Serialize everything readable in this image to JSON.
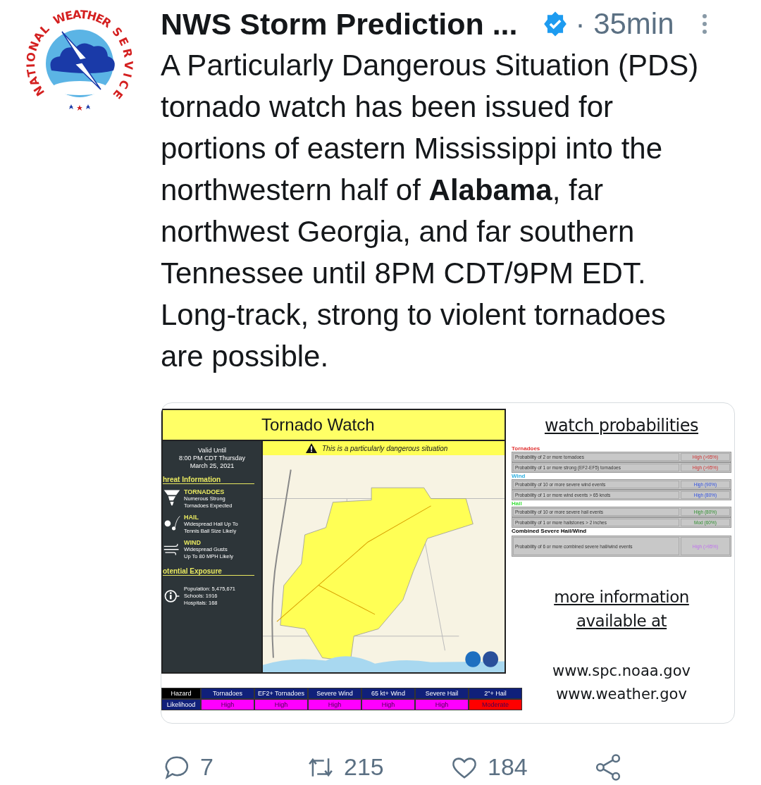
{
  "avatar": {
    "ring_words": [
      "NATIONAL",
      "WEATHER",
      "SERVICE"
    ]
  },
  "tweet": {
    "author": "NWS Storm Prediction ...",
    "verified": true,
    "time": "· 35min",
    "text": "A Particularly Dangerous Situation (PDS) tornado watch has been issued for portions of eastern Mississippi into the northwestern half of **Alabama**, far northwest Georgia, and far southern Tennessee until 8PM CDT/9PM EDT. Long-track, strong to violent tornadoes are possible."
  },
  "graphic": {
    "title": "Tornado Watch",
    "valid": [
      "Valid Until",
      "8:00 PM CDT Thursday",
      "March 25, 2021"
    ],
    "threat_heading": "hreat Information",
    "threats": [
      {
        "kind": "tornado",
        "name": "TORNADOES",
        "detail": [
          "Numerous Strong",
          "Tornadoes Expected"
        ]
      },
      {
        "kind": "hail",
        "name": "HAIL",
        "detail": [
          "Widespread Hail Up To",
          "Tennis Ball Size Likely"
        ]
      },
      {
        "kind": "wind",
        "name": "WIND",
        "detail": [
          "Widespread Gusts",
          "Up To 80 MPH Likely"
        ]
      }
    ],
    "exposure_heading": "otential Exposure",
    "exposure": [
      "Population: 5,475,671",
      "Schools: 1916",
      "Hospitals: 168"
    ],
    "banner": "This is a particularly dangerous situation",
    "map": {
      "kind": "picture"
    },
    "hazard_table": {
      "row_labels": [
        "Hazard",
        "Likelihood"
      ],
      "columns": [
        {
          "hazard": "Tornadoes",
          "likelihood": "High",
          "color": "#ff00ff"
        },
        {
          "hazard": "EF2+ Tornadoes",
          "likelihood": "High",
          "color": "#ff00ff"
        },
        {
          "hazard": "Severe Wind",
          "likelihood": "High",
          "color": "#ff00ff"
        },
        {
          "hazard": "65 kt+ Wind",
          "likelihood": "High",
          "color": "#ff00ff"
        },
        {
          "hazard": "Severe Hail",
          "likelihood": "High",
          "color": "#ff00ff"
        },
        {
          "hazard": "2\"+ Hail",
          "likelihood": "Moderate",
          "color": "#ff0000"
        }
      ]
    },
    "probabilities_heading": "watch probabilities",
    "probability_groups": [
      {
        "name": "Tornadoes",
        "color": "#e03030",
        "rows": [
          {
            "label": "Probability of 2 or more tornadoes",
            "value": "High (>95%)"
          },
          {
            "label": "Probability of 1 or more strong (EF2-EF5) tornadoes",
            "value": "High (>95%)"
          }
        ]
      },
      {
        "name": "Wind",
        "color": "#30b0e0",
        "rows": [
          {
            "label": "Probability of 10 or more severe wind events",
            "value": "High (90%)"
          },
          {
            "label": "Probability of 1 or more wind events > 65 knots",
            "value": "High (80%)"
          }
        ]
      },
      {
        "name": "Hail",
        "color": "#40e040",
        "rows": [
          {
            "label": "Probability of 10 or more severe hail events",
            "value": "High (80%)"
          },
          {
            "label": "Probability of 1 or more hailstones > 2 inches",
            "value": "Mod (60%)"
          }
        ]
      },
      {
        "name": "Combined Severe Hail/Wind",
        "color": "#000000",
        "rows": [
          {
            "label": "Probability of 6 or more combined severe hail/wind events",
            "value": "High (>95%)"
          }
        ]
      }
    ],
    "more_info": [
      "more information",
      "available at"
    ],
    "urls": [
      "www.spc.noaa.gov",
      "www.weather.gov"
    ]
  },
  "actions": [
    {
      "kind": "reply",
      "count": "7"
    },
    {
      "kind": "retweet",
      "count": "215"
    },
    {
      "kind": "like",
      "count": "184"
    },
    {
      "kind": "share"
    }
  ]
}
